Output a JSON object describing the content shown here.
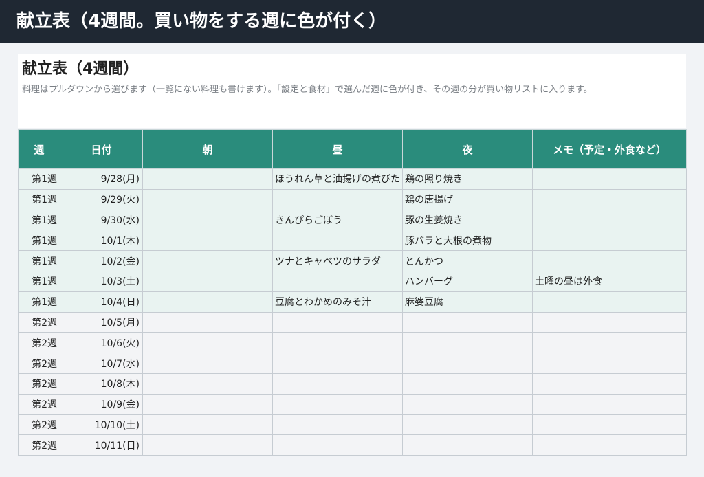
{
  "header": {
    "title": "献立表（4週間。買い物をする週に色が付く）"
  },
  "panel": {
    "title": "献立表（4週間）",
    "description": "料理はプルダウンから選びます（一覧にない料理も書けます）。「設定と食材」で選んだ週に色が付き、その週の分が買い物リストに入ります。"
  },
  "table": {
    "headers": [
      "週",
      "日付",
      "朝",
      "昼",
      "夜",
      "メモ（予定・外食など）"
    ],
    "rows": [
      {
        "week": "第1週",
        "date": "9/28(月)",
        "breakfast": "",
        "lunch": "ほうれん草と油揚げの煮びたし",
        "dinner": "鶏の照り焼き",
        "memo": ""
      },
      {
        "week": "第1週",
        "date": "9/29(火)",
        "breakfast": "",
        "lunch": "",
        "dinner": "鶏の唐揚げ",
        "memo": ""
      },
      {
        "week": "第1週",
        "date": "9/30(水)",
        "breakfast": "",
        "lunch": "きんぴらごぼう",
        "dinner": "豚の生姜焼き",
        "memo": ""
      },
      {
        "week": "第1週",
        "date": "10/1(木)",
        "breakfast": "",
        "lunch": "",
        "dinner": "豚バラと大根の煮物",
        "memo": ""
      },
      {
        "week": "第1週",
        "date": "10/2(金)",
        "breakfast": "",
        "lunch": "ツナとキャベツのサラダ",
        "dinner": "とんかつ",
        "memo": ""
      },
      {
        "week": "第1週",
        "date": "10/3(土)",
        "breakfast": "",
        "lunch": "",
        "dinner": "ハンバーグ",
        "memo": "土曜の昼は外食"
      },
      {
        "week": "第1週",
        "date": "10/4(日)",
        "breakfast": "",
        "lunch": "豆腐とわかめのみそ汁",
        "dinner": "麻婆豆腐",
        "memo": ""
      },
      {
        "week": "第2週",
        "date": "10/5(月)",
        "breakfast": "",
        "lunch": "",
        "dinner": "",
        "memo": ""
      },
      {
        "week": "第2週",
        "date": "10/6(火)",
        "breakfast": "",
        "lunch": "",
        "dinner": "",
        "memo": ""
      },
      {
        "week": "第2週",
        "date": "10/7(水)",
        "breakfast": "",
        "lunch": "",
        "dinner": "",
        "memo": ""
      },
      {
        "week": "第2週",
        "date": "10/8(木)",
        "breakfast": "",
        "lunch": "",
        "dinner": "",
        "memo": ""
      },
      {
        "week": "第2週",
        "date": "10/9(金)",
        "breakfast": "",
        "lunch": "",
        "dinner": "",
        "memo": ""
      },
      {
        "week": "第2週",
        "date": "10/10(土)",
        "breakfast": "",
        "lunch": "",
        "dinner": "",
        "memo": ""
      },
      {
        "week": "第2週",
        "date": "10/11(日)",
        "breakfast": "",
        "lunch": "",
        "dinner": "",
        "memo": ""
      }
    ]
  },
  "colors": {
    "header_bar": "#1f2833",
    "table_header": "#2a8c7c",
    "shopping_week_row": "#e9f3f1",
    "other_row": "#f3f4f6"
  }
}
